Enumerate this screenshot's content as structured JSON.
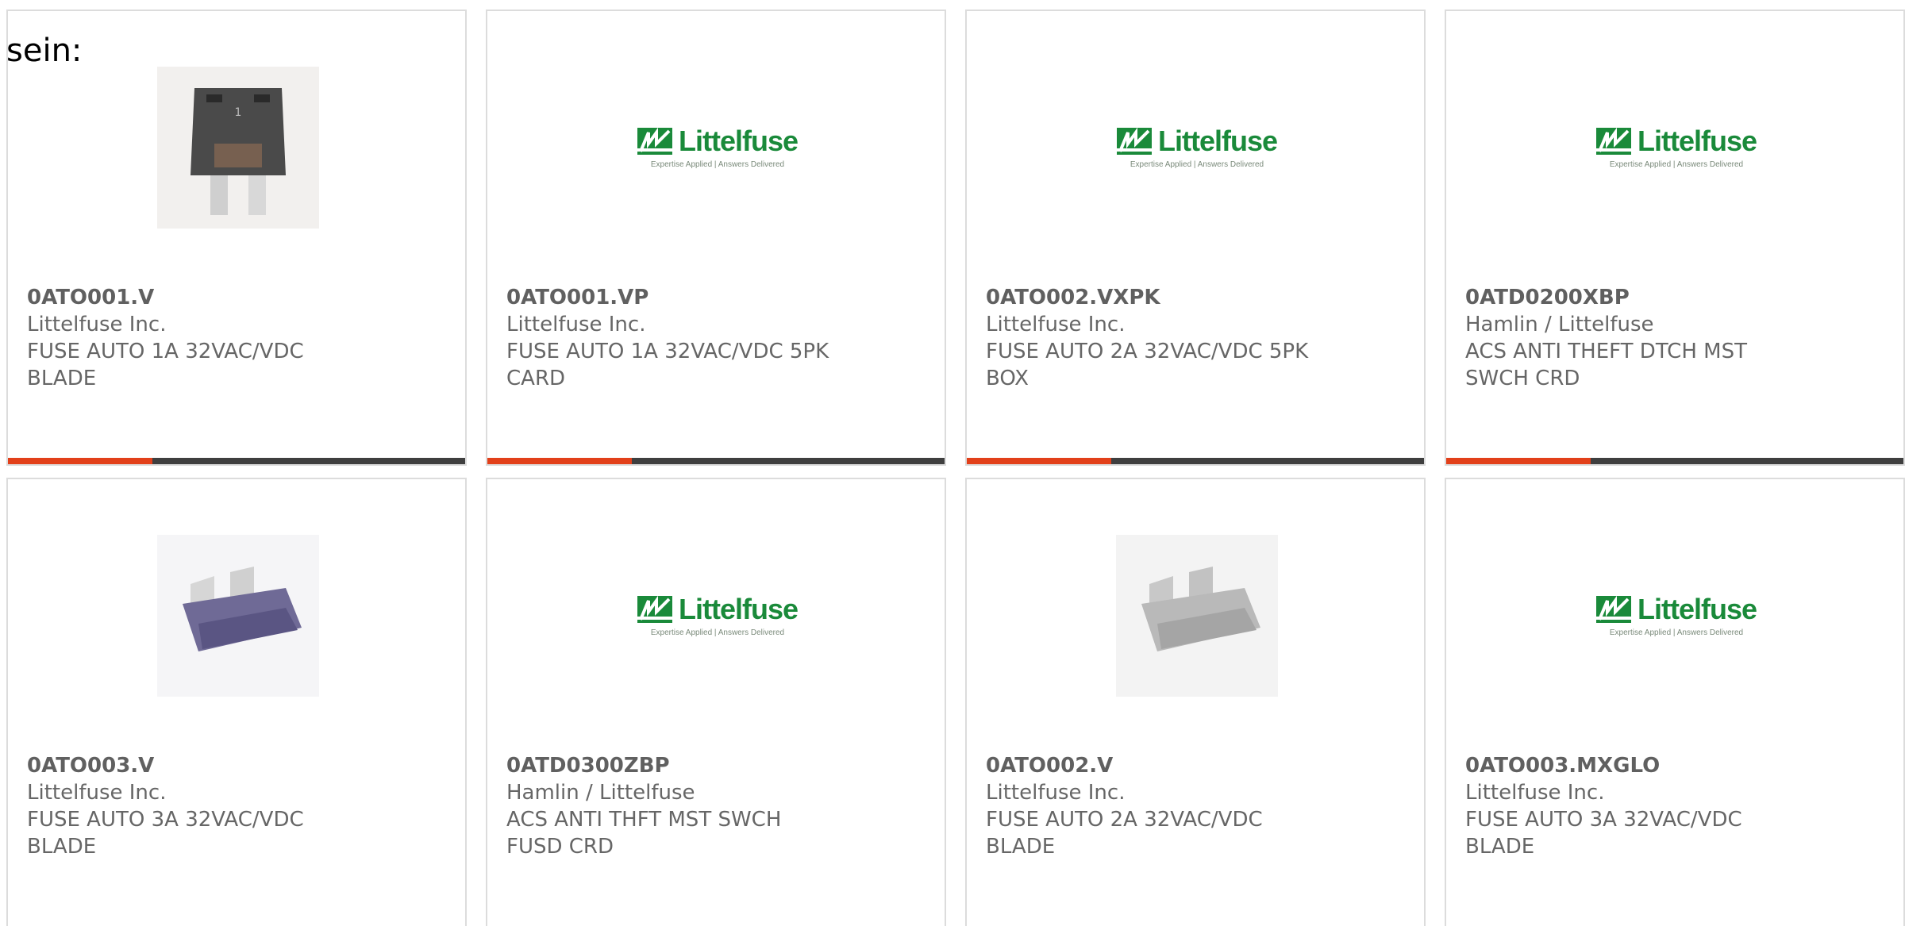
{
  "intro_text": "sein:",
  "logo": {
    "word": "Littelfuse",
    "tagline": "Expertise Applied | Answers Delivered"
  },
  "colors": {
    "accent": "#e2401a",
    "bar": "#3f3f3f",
    "logo_green": "#1a8a3a",
    "border": "#dcdcdc"
  },
  "products": [
    {
      "part_number": "0ATO001.V",
      "manufacturer": "Littelfuse Inc.",
      "description": "FUSE AUTO 1A 32VAC/VDC BLADE",
      "image": "fuse-dark-photo"
    },
    {
      "part_number": "0ATO001.VP",
      "manufacturer": "Littelfuse Inc.",
      "description": "FUSE AUTO 1A 32VAC/VDC 5PK CARD",
      "image": "littelfuse-logo"
    },
    {
      "part_number": "0ATO002.VXPK",
      "manufacturer": "Littelfuse Inc.",
      "description": "FUSE AUTO 2A 32VAC/VDC 5PK BOX",
      "image": "littelfuse-logo"
    },
    {
      "part_number": "0ATD0200XBP",
      "manufacturer": "Hamlin / Littelfuse",
      "description": "ACS ANTI THEFT DTCH MST SWCH CRD",
      "image": "littelfuse-logo"
    },
    {
      "part_number": "0ATO003.V",
      "manufacturer": "Littelfuse Inc.",
      "description": "FUSE AUTO 3A 32VAC/VDC BLADE",
      "image": "fuse-violet-photo"
    },
    {
      "part_number": "0ATD0300ZBP",
      "manufacturer": "Hamlin / Littelfuse",
      "description": "ACS ANTI THFT MST SWCH FUSD CRD",
      "image": "littelfuse-logo"
    },
    {
      "part_number": "0ATO002.V",
      "manufacturer": "Littelfuse Inc.",
      "description": "FUSE AUTO 2A 32VAC/VDC BLADE",
      "image": "fuse-clear-photo"
    },
    {
      "part_number": "0ATO003.MXGLO",
      "manufacturer": "Littelfuse Inc.",
      "description": "FUSE AUTO 3A 32VAC/VDC BLADE",
      "image": "littelfuse-logo"
    }
  ]
}
